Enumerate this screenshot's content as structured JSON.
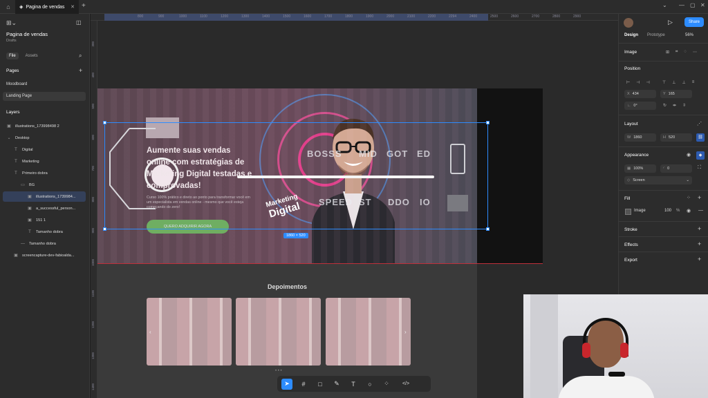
{
  "app": {
    "tab_title": "Pagina de vendas",
    "file_title": "Pagina de vendas",
    "file_location": "Drafts"
  },
  "left_panel": {
    "tabs": [
      "File",
      "Assets"
    ],
    "pages_header": "Pages",
    "pages": [
      "Moodboard",
      "Landing Page"
    ],
    "layers_header": "Layers",
    "layers": [
      {
        "label": "illustrations_173998498 2",
        "icon": "image-icon"
      },
      {
        "label": "Desktop",
        "icon": "frame-icon"
      },
      {
        "label": "Digital",
        "icon": "text-icon"
      },
      {
        "label": "Marketing",
        "icon": "text-icon"
      },
      {
        "label": "Primeiro dobra",
        "icon": "text-icon"
      },
      {
        "label": "BG",
        "icon": "rectangle-icon"
      },
      {
        "label": "illustrations_1739984...",
        "icon": "image-icon"
      },
      {
        "label": "a_successful_person...",
        "icon": "image-icon"
      },
      {
        "label": "151 1",
        "icon": "image-icon"
      },
      {
        "label": "Tamanho dobra",
        "icon": "text-icon"
      },
      {
        "label": "Tamanho dobra",
        "icon": "line-icon"
      },
      {
        "label": "screencapture-dev-fabioalda...",
        "icon": "image-icon"
      }
    ]
  },
  "rulers": {
    "top": [
      "800",
      "900",
      "1000",
      "1100",
      "1200",
      "1300",
      "1400",
      "1500",
      "1600",
      "1700",
      "1800",
      "1900",
      "2000",
      "2100",
      "2200",
      "2294",
      "2400",
      "2500",
      "2600",
      "2700",
      "2800",
      "2900"
    ],
    "left": [
      "300",
      "400",
      "500",
      "600",
      "700",
      "800",
      "900",
      "1000",
      "1100",
      "1200",
      "1300",
      "1400"
    ]
  },
  "canvas": {
    "headline": "Aumente suas vendas online com estratégias de Marketing Digital testadas e comprovadas!",
    "subcopy": "Curso 100% prático e direto ao ponto para transformar você em um especialista em vendas online - mesmo que você esteja começando do zero!",
    "cta": "QUERO ADQUIRIR AGORA",
    "big_words_row1": [
      "BOSSS",
      "MID",
      "GOT",
      "ED"
    ],
    "big_words_row2": [
      "SPEED",
      "ST",
      "DDO",
      "IO"
    ],
    "marketing_digital": [
      "Marketing",
      "Digital"
    ],
    "depoimentos_title": "Depoimentos",
    "selection_size": "1860 × 520",
    "carousel_prev": "‹",
    "carousel_next": "›",
    "carousel_dots": "• • •"
  },
  "toolbar": {
    "tools": [
      {
        "name": "move-tool",
        "glyph": "➤",
        "active": true
      },
      {
        "name": "frame-tool",
        "glyph": "#",
        "active": false
      },
      {
        "name": "shape-tool",
        "glyph": "□",
        "active": false
      },
      {
        "name": "pen-tool",
        "glyph": "✎",
        "active": false
      },
      {
        "name": "text-tool",
        "glyph": "T",
        "active": false
      },
      {
        "name": "comment-tool",
        "glyph": "○",
        "active": false
      },
      {
        "name": "components-tool",
        "glyph": "⁘",
        "active": false
      },
      {
        "name": "dev-mode-tool",
        "glyph": "</>",
        "active": false
      }
    ]
  },
  "right_panel": {
    "share_label": "Share",
    "tabs": [
      "Design",
      "Prototype"
    ],
    "zoom": "56%",
    "layer_type": "Image",
    "position_header": "Position",
    "x_label": "X",
    "x_value": "434",
    "y_label": "Y",
    "y_value": "165",
    "rotation_value": "0°",
    "layout_header": "Layout",
    "w_label": "W",
    "w_value": "1860",
    "h_label": "H",
    "h_value": "520",
    "appearance_header": "Appearance",
    "opacity": "100%",
    "corner_radius": "0",
    "blend_mode": "Screen",
    "fill_header": "Fill",
    "fill_type": "Image",
    "fill_opacity": "100",
    "fill_percent": "%",
    "stroke_header": "Stroke",
    "effects_header": "Effects",
    "export_header": "Export"
  },
  "colors": {
    "accent": "#2d8cff",
    "cta_green": "#6fae62",
    "panel_bg": "#2c2c2c",
    "canvas_bg": "#2a2a2a"
  }
}
